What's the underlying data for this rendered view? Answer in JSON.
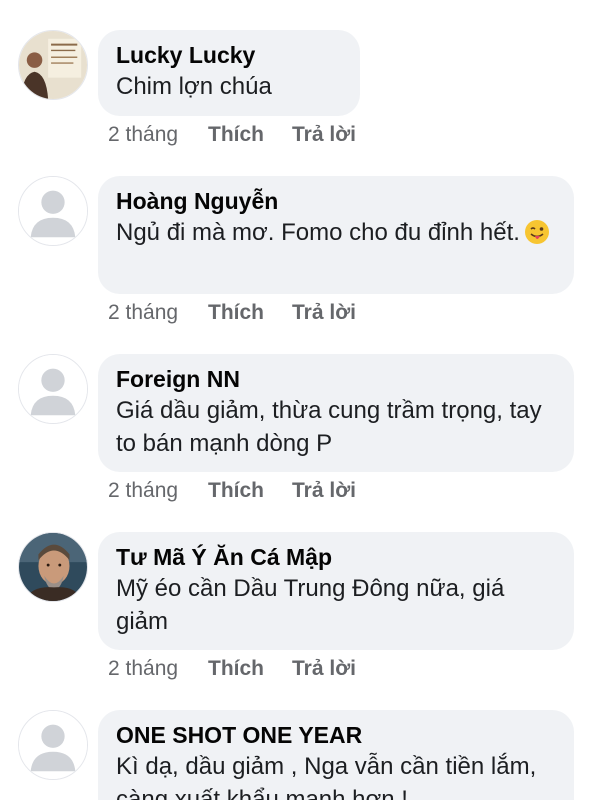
{
  "comments": [
    {
      "author": "Lucky Lucky",
      "text": "Chim lợn chúa",
      "time": "2 tháng",
      "like": "Thích",
      "reply": "Trả lời",
      "avatar": "photo"
    },
    {
      "author": "Hoàng Nguyễn",
      "text": "Ngủ đi mà mơ. Fomo cho đu đỉnh hết.",
      "emoji": "winking-tongue-emoji",
      "time": "2 tháng",
      "like": "Thích",
      "reply": "Trả lời",
      "avatar": "default"
    },
    {
      "author": "Foreign NN",
      "text": "Giá dầu giảm, thừa cung trầm trọng, tay to bán mạnh dòng P",
      "time": "2 tháng",
      "like": "Thích",
      "reply": "Trả lời",
      "avatar": "default"
    },
    {
      "author": "Tư Mã Ý Ăn Cá Mập",
      "text": "Mỹ éo cần Dầu Trung Đông nữa, giá giảm",
      "time": "2 tháng",
      "like": "Thích",
      "reply": "Trả lời",
      "avatar": "photo"
    },
    {
      "author": "ONE SHOT ONE YEAR",
      "text": "Kì dạ, dầu giảm , Nga vẫn cần tiền lắm, càng xuất khẩu mạnh hơn !",
      "time": "",
      "like": "",
      "reply": "",
      "avatar": "default"
    }
  ],
  "colors": {
    "bubble": "#f0f2f5",
    "meta": "#65676b",
    "author": "#050505"
  }
}
